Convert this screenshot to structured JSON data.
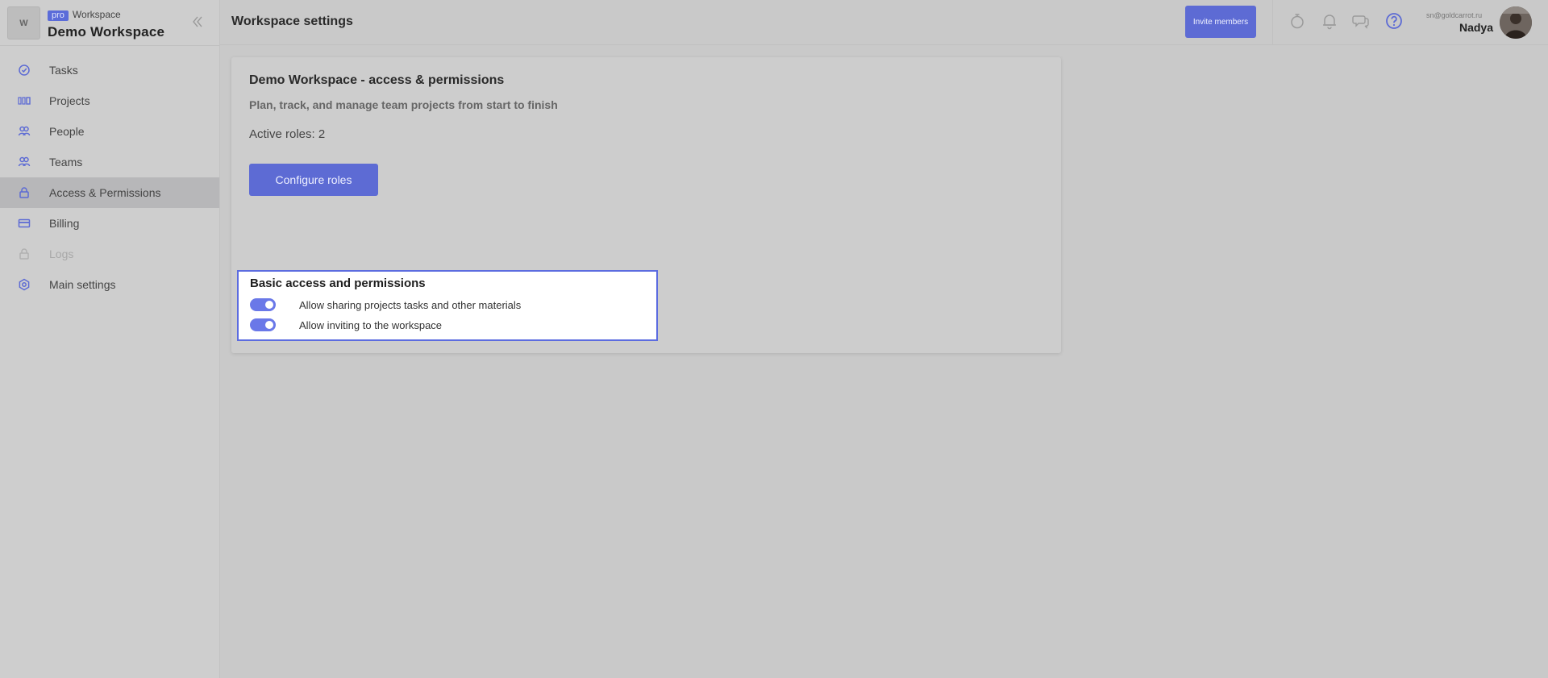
{
  "workspace": {
    "avatar_letter": "W",
    "badge": "pro",
    "type_label": "Workspace",
    "name": "Demo Workspace"
  },
  "sidebar": {
    "items": [
      {
        "label": "Tasks",
        "icon": "tasks-icon",
        "active": false,
        "disabled": false
      },
      {
        "label": "Projects",
        "icon": "projects-icon",
        "active": false,
        "disabled": false
      },
      {
        "label": "People",
        "icon": "people-icon",
        "active": false,
        "disabled": false
      },
      {
        "label": "Teams",
        "icon": "teams-icon",
        "active": false,
        "disabled": false
      },
      {
        "label": "Access & Permissions",
        "icon": "lock-icon",
        "active": true,
        "disabled": false
      },
      {
        "label": "Billing",
        "icon": "billing-icon",
        "active": false,
        "disabled": false
      },
      {
        "label": "Logs",
        "icon": "lock-icon",
        "active": false,
        "disabled": true
      },
      {
        "label": "Main settings",
        "icon": "settings-icon",
        "active": false,
        "disabled": false
      }
    ]
  },
  "header": {
    "title": "Workspace settings",
    "invite_label": "Invite members",
    "icons": [
      "timer-icon",
      "bell-icon",
      "chat-icon",
      "help-icon"
    ]
  },
  "user": {
    "email": "sn@goldcarrot.ru",
    "name": "Nadya"
  },
  "card": {
    "title": "Demo Workspace - access & permissions",
    "subtitle": "Plan, track, and manage team projects from start to finish",
    "active_roles": "Active roles: 2",
    "configure_label": "Configure roles"
  },
  "permissions": {
    "title": "Basic access and permissions",
    "items": [
      {
        "label": "Allow sharing projects tasks and other materials",
        "enabled": true
      },
      {
        "label": "Allow inviting to the workspace",
        "enabled": true
      }
    ]
  },
  "colors": {
    "accent": "#5d6bd4",
    "toggle_on": "#6a78e8",
    "highlight_border": "#5c6ce0"
  }
}
